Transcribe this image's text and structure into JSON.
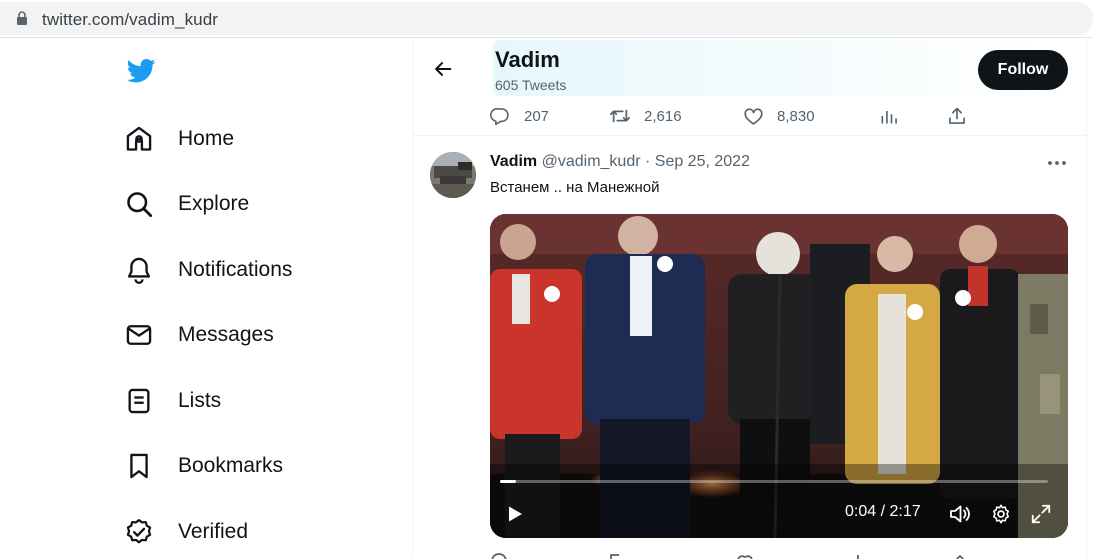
{
  "browser": {
    "url": "twitter.com/vadim_kudr"
  },
  "sidebar": {
    "logo": "twitter-bird-icon",
    "items": [
      {
        "label": "Home",
        "icon": "home-icon"
      },
      {
        "label": "Explore",
        "icon": "search-icon"
      },
      {
        "label": "Notifications",
        "icon": "bell-icon"
      },
      {
        "label": "Messages",
        "icon": "envelope-icon"
      },
      {
        "label": "Lists",
        "icon": "list-icon"
      },
      {
        "label": "Bookmarks",
        "icon": "bookmark-icon"
      },
      {
        "label": "Verified",
        "icon": "verified-icon"
      }
    ]
  },
  "header": {
    "name": "Vadim",
    "tweet_count": "605 Tweets",
    "follow_label": "Follow"
  },
  "prev_tweet_actions": {
    "replies": "207",
    "retweets": "2,616",
    "likes": "8,830"
  },
  "tweet": {
    "author": "Vadim",
    "handle": "@vadim_kudr",
    "separator": " · ",
    "date": "Sep 25, 2022",
    "text": "Встанем .. на Манежной",
    "video": {
      "time": "0:04 / 2:17",
      "progress": 0.03
    }
  },
  "colors": {
    "brand": "#1d9bf0",
    "text_primary": "#0f1419",
    "text_secondary": "#536471",
    "follow_bg": "#0f1419"
  }
}
